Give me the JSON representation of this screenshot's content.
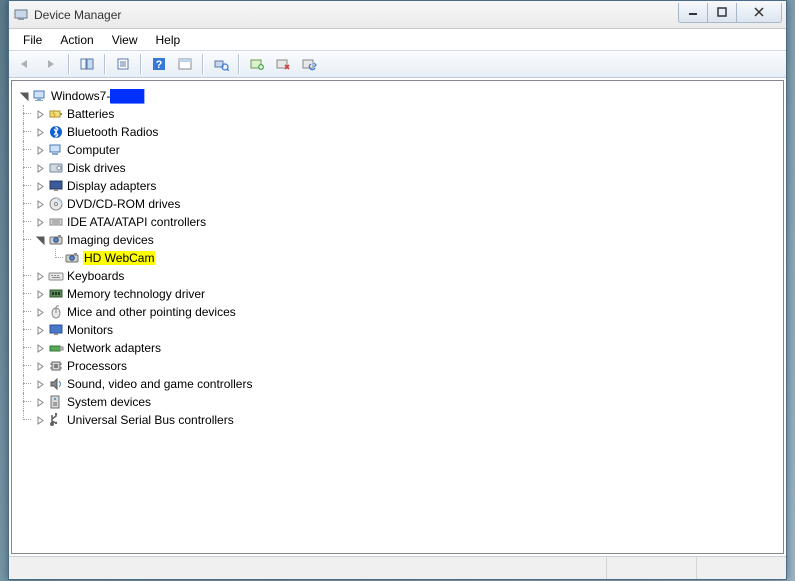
{
  "window": {
    "title": "Device Manager"
  },
  "menu": {
    "file": "File",
    "action": "Action",
    "view": "View",
    "help": "Help"
  },
  "tree": {
    "root": "Windows7-",
    "root_suffix_redacted": "████",
    "items": [
      {
        "label": "Batteries",
        "icon": "battery"
      },
      {
        "label": "Bluetooth Radios",
        "icon": "bluetooth"
      },
      {
        "label": "Computer",
        "icon": "computer"
      },
      {
        "label": "Disk drives",
        "icon": "disk"
      },
      {
        "label": "Display adapters",
        "icon": "display"
      },
      {
        "label": "DVD/CD-ROM drives",
        "icon": "cdrom"
      },
      {
        "label": "IDE ATA/ATAPI controllers",
        "icon": "ide"
      },
      {
        "label": "Imaging devices",
        "icon": "imaging",
        "expanded": true,
        "children": [
          {
            "label": "HD WebCam",
            "icon": "webcam",
            "highlight": true
          }
        ]
      },
      {
        "label": "Keyboards",
        "icon": "keyboard"
      },
      {
        "label": "Memory technology driver",
        "icon": "memory"
      },
      {
        "label": "Mice and other pointing devices",
        "icon": "mouse"
      },
      {
        "label": "Monitors",
        "icon": "monitor"
      },
      {
        "label": "Network adapters",
        "icon": "network"
      },
      {
        "label": "Processors",
        "icon": "cpu"
      },
      {
        "label": "Sound, video and game controllers",
        "icon": "sound"
      },
      {
        "label": "System devices",
        "icon": "system"
      },
      {
        "label": "Universal Serial Bus controllers",
        "icon": "usb"
      }
    ]
  }
}
